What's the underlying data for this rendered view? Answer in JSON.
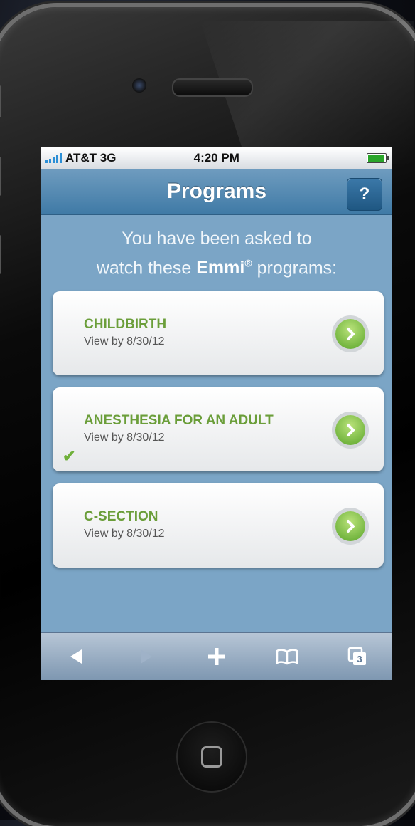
{
  "status": {
    "carrier": "AT&T 3G",
    "time": "4:20 PM"
  },
  "nav": {
    "title": "Programs",
    "help_label": "?"
  },
  "intro": {
    "line1": "You have been asked to",
    "line2_pre": "watch these",
    "brand": "Emmi",
    "reg": "®",
    "line2_post": "programs:"
  },
  "programs": [
    {
      "title": "CHILDBIRTH",
      "due": "View by 8/30/12",
      "completed": false
    },
    {
      "title": "ANESTHESIA FOR AN ADULT",
      "due": "View by 8/30/12",
      "completed": true
    },
    {
      "title": "C-SECTION",
      "due": "View by 8/30/12",
      "completed": false
    }
  ],
  "toolbar": {
    "back_icon": "back-arrow-icon",
    "forward_icon": "forward-arrow-icon",
    "add_icon": "plus-icon",
    "bookmarks_icon": "book-icon",
    "pages_icon": "pages-icon",
    "pages_count": "3"
  },
  "colors": {
    "screen_bg": "#7ba5c6",
    "nav_bg": "#3f7aa6",
    "program_title": "#6b9e3a",
    "go_button": "#5aa52a"
  }
}
